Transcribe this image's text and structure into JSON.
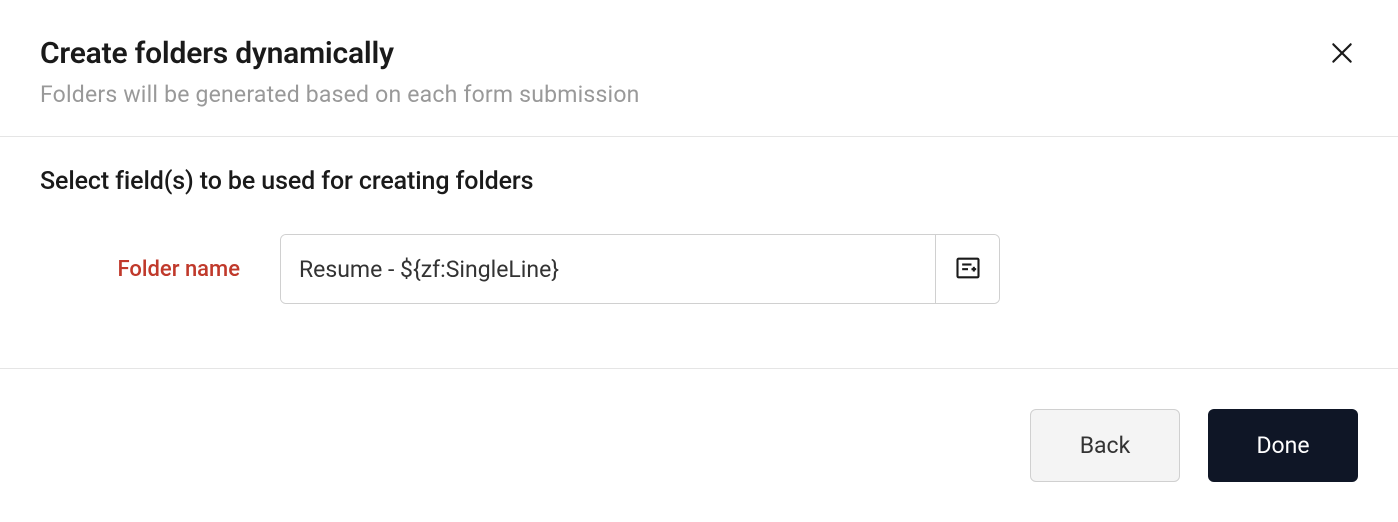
{
  "modal": {
    "title": "Create folders dynamically",
    "subtitle": "Folders will be generated based on each form submission"
  },
  "body": {
    "section_title": "Select field(s) to be used for creating folders",
    "field_label": "Folder name",
    "folder_name_value": "Resume - ${zf:SingleLine}"
  },
  "footer": {
    "back_label": "Back",
    "done_label": "Done"
  },
  "icons": {
    "close": "close-icon",
    "insert_field": "insert-field-icon"
  }
}
